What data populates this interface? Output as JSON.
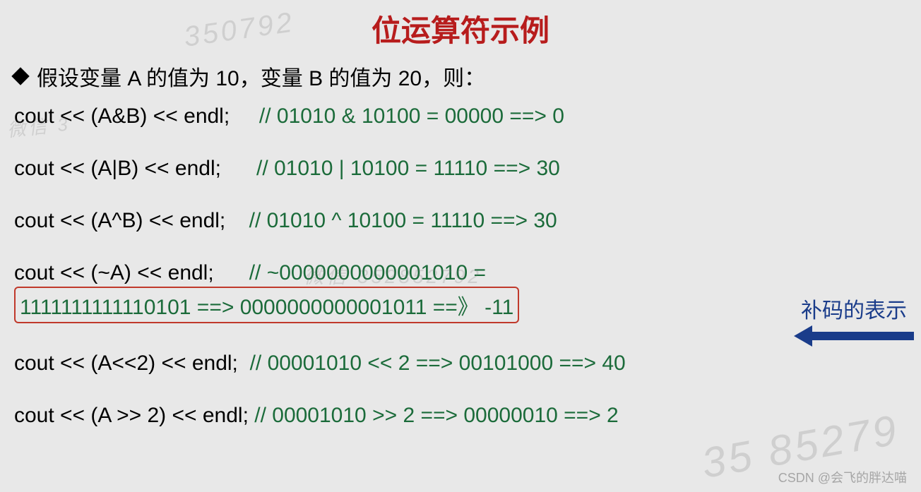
{
  "title": "位运算符示例",
  "intro": "假设变量 A 的值为 10，变量 B 的值为 20，则：",
  "lines": {
    "and": {
      "code": "cout << (A&B) << endl;",
      "comment": "//  01010 & 10100  = 00000  ==> 0"
    },
    "or": {
      "code": "cout << (A|B) << endl;",
      "comment": "//  01010 | 10100  = 11110  ==> 30"
    },
    "xor": {
      "code": "cout << (A^B) << endl;",
      "comment": "//  01010 ^ 10100  = 11110 ==> 30"
    },
    "not": {
      "code": "cout << (~A) << endl;",
      "comment": "//  ~0000000000001010 ="
    },
    "not2": {
      "boxed": "1111111111110101   ==> 0000000000001011 ==》 -11"
    },
    "shl": {
      "code": "cout << (A<<2) << endl;",
      "comment": "// 00001010 << 2 ==> 00101000 ==> 40"
    },
    "shr": {
      "code": "cout << (A >> 2)  << endl;",
      "comment": "// 00001010 >> 2 ==> 00000010  ==> 2"
    }
  },
  "annotation": "补码的表示",
  "watermarks": {
    "w1": "350792",
    "w2": "微信 352852792",
    "w3": "35 85279",
    "w4": "微信 3"
  },
  "csdn": "CSDN @会飞的胖达喵"
}
